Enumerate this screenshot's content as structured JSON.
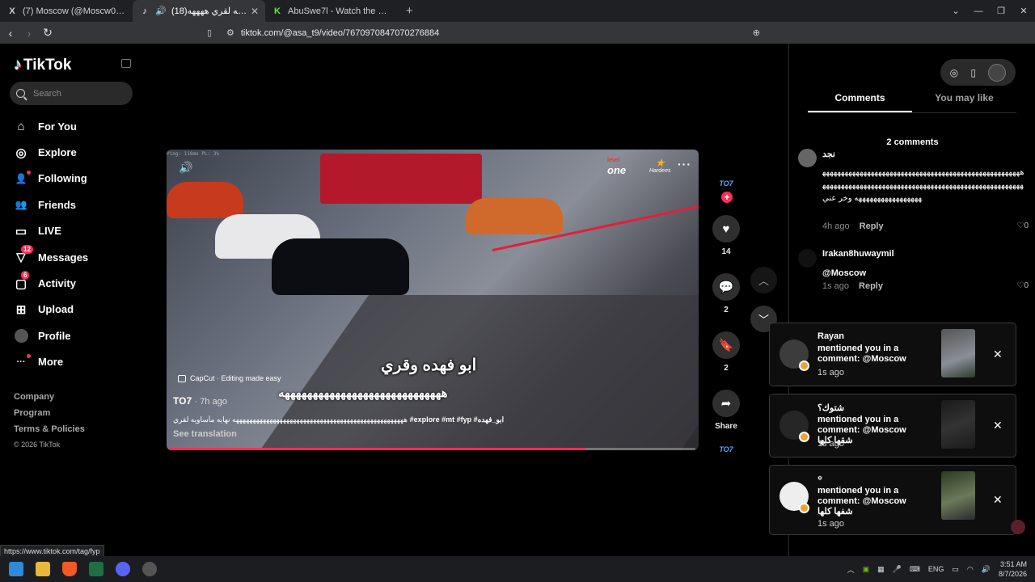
{
  "browser": {
    "tabs": [
      {
        "icon": "x-logo-icon",
        "icon_text": "X",
        "title": "(7) Moscow (@Moscw0) / X",
        "active": false
      },
      {
        "icon": "tiktok-icon",
        "icon_text": "♪",
        "title": "(18)نهاية مأساويه لقري ههههه",
        "active": true
      },
      {
        "icon": "kick-icon",
        "icon_text": "K",
        "title": "AbuSwe7l - Watch the VOD on Kick",
        "active": false
      }
    ],
    "new_tab": "+",
    "url": "tiktok.com/@asa_t9/video/7670970847070276884",
    "status_url": "https://www.tiktok.com/tag/fyp"
  },
  "sidebar": {
    "logo": "TikTok",
    "search_placeholder": "Search",
    "menu": [
      {
        "label": "For You",
        "icon": "home-icon",
        "glyph": "⌂",
        "badge": ""
      },
      {
        "label": "Explore",
        "icon": "compass-icon",
        "glyph": "◎",
        "badge": ""
      },
      {
        "label": "Following",
        "icon": "following-icon",
        "glyph": "👤",
        "badge": "dot"
      },
      {
        "label": "Friends",
        "icon": "friends-icon",
        "glyph": "👥",
        "badge": ""
      },
      {
        "label": "LIVE",
        "icon": "live-icon",
        "glyph": "▭",
        "badge": ""
      },
      {
        "label": "Messages",
        "icon": "messages-icon",
        "glyph": "▽",
        "badge": "12"
      },
      {
        "label": "Activity",
        "icon": "activity-icon",
        "glyph": "▢",
        "badge": "6"
      },
      {
        "label": "Upload",
        "icon": "upload-icon",
        "glyph": "⊞",
        "badge": ""
      },
      {
        "label": "Profile",
        "icon": "profile-avatar-icon",
        "glyph": "",
        "badge": ""
      },
      {
        "label": "More",
        "icon": "more-icon",
        "glyph": "···",
        "badge": "dot"
      }
    ],
    "footer": [
      "Company",
      "Program",
      "Terms & Policies"
    ],
    "copyright": "© 2026 TikTok"
  },
  "video": {
    "hud": "Ping: 118ms  PL: 3%",
    "brand1_top": "level",
    "brand1": "one",
    "brand2": "Hardees",
    "subtitle": "ابو فهده وقري",
    "capcut": "CapCut · Editing made easy",
    "overlay_text": "هههههههههههههههههههههههههههههه",
    "author": "TO7",
    "time_ago": "· 7h ago",
    "description_prefix": "هههههههههههههههههههههههههههههههههههههههههههههههههههه نهايه مأساويه لقري ",
    "tags": "#explore #mt #fyp",
    "description_suffix": " #ابو_فهده",
    "see_translation": "See translation",
    "progress_fraction": 0.79
  },
  "actions": {
    "creator_badge": "TO7",
    "likes": "14",
    "comments": "2",
    "saves": "2",
    "share_label": "Share",
    "music_badge": "TO7"
  },
  "panel": {
    "tabs": [
      "Comments",
      "You may like"
    ],
    "count": "2 comments",
    "comments": [
      {
        "name": "نجد",
        "text": "هههههههههههههههههههههههههههههههههههههههههههههههههههههههههههههههههههههههههههههههههههههههههههههههههههههههههههههههههههههههههههههه وخر عني",
        "time": "4h ago",
        "reply": "Reply",
        "likes": "0"
      },
      {
        "name": "Irakan8huwaymil",
        "text": "@Moscow",
        "time": "1s ago",
        "reply": "Reply",
        "likes": "0"
      }
    ]
  },
  "notifications": [
    {
      "name": "Rayan",
      "message": "mentioned you in a comment: @Moscow",
      "time": "1s ago"
    },
    {
      "name": "شتوك؟",
      "message": "mentioned you in a comment: @Moscow شقها كلها",
      "time": "1s ago"
    },
    {
      "name": "꙳",
      "message": "mentioned you in a comment: @Moscow شفها كلها",
      "time": "1s ago"
    }
  ],
  "taskbar": {
    "language": "ENG",
    "time": "3:51 AM",
    "date": "8/7/2026"
  }
}
